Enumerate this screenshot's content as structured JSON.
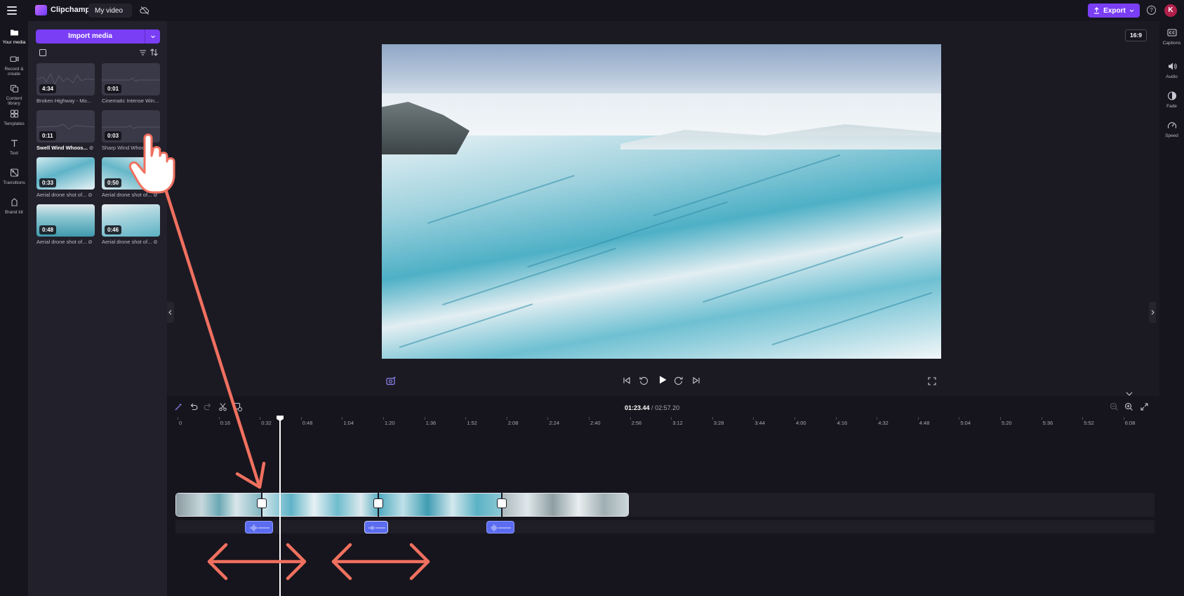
{
  "app": {
    "brand": "Clipchamp",
    "project_title": "My video"
  },
  "header": {
    "export_label": "Export",
    "help_glyph": "?",
    "avatar_initial": "K"
  },
  "left_rail": [
    {
      "label": "Your media",
      "icon": "folder-icon"
    },
    {
      "label": "Record & create",
      "icon": "camera-icon"
    },
    {
      "label": "Content library",
      "icon": "library-icon"
    },
    {
      "label": "Templates",
      "icon": "templates-icon"
    },
    {
      "label": "Text",
      "icon": "text-icon"
    },
    {
      "label": "Transitions",
      "icon": "transitions-icon"
    },
    {
      "label": "Brand kit",
      "icon": "brand-kit-icon"
    }
  ],
  "media_panel": {
    "import_label": "Import media",
    "items": [
      {
        "duration": "4:34",
        "name": "Broken Highway - Mo..."
      },
      {
        "duration": "0:01",
        "name": "Cinematic Intense Win..."
      },
      {
        "duration": "0:11",
        "name": "Swell Wind Whoos..."
      },
      {
        "duration": "0:03",
        "name": "Sharp Wind Whoo..."
      },
      {
        "duration": "0:33",
        "name": "Aerial drone shot of..."
      },
      {
        "duration": "0:50",
        "name": "Aerial drone shot of..."
      },
      {
        "duration": "0:48",
        "name": "Aerial drone shot of..."
      },
      {
        "duration": "0:46",
        "name": "Aerial drone shot of..."
      }
    ]
  },
  "preview": {
    "aspect_ratio": "16:9"
  },
  "right_rail": [
    {
      "label": "Captions",
      "icon": "captions-icon"
    },
    {
      "label": "Audio",
      "icon": "speaker-icon"
    },
    {
      "label": "Fade",
      "icon": "fade-icon"
    },
    {
      "label": "Speed",
      "icon": "speed-icon"
    }
  ],
  "timeline": {
    "current_time": "01:23.44",
    "total_time": "02:57.20",
    "ruler": [
      "0",
      "0:16",
      "0:32",
      "0:48",
      "1:04",
      "1:20",
      "1:36",
      "1:52",
      "2:08",
      "2:24",
      "2:40",
      "2:56",
      "3:12",
      "3:28",
      "3:44",
      "4:00",
      "4:16",
      "4:32",
      "4:48",
      "5:04",
      "5:20",
      "5:36",
      "5:52",
      "6:08"
    ]
  },
  "colors": {
    "accent": "#7a3ef5",
    "annotation": "#f0705f",
    "audio_clip": "#5b6cf0"
  }
}
